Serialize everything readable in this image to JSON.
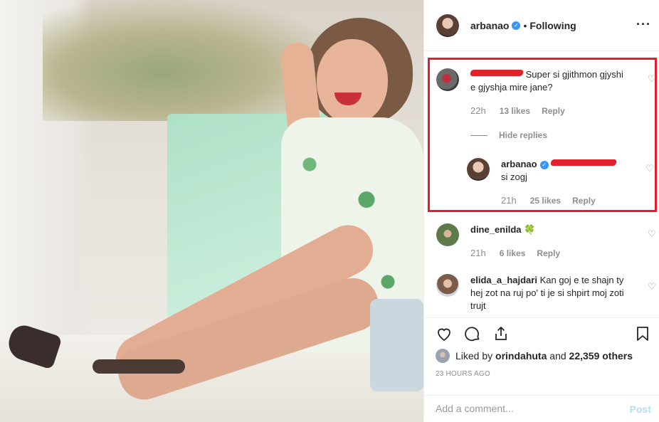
{
  "post": {
    "username": "arbanao",
    "separator": "•",
    "follow_status": "Following",
    "more_icon": "more-options-icon"
  },
  "comments": [
    {
      "username_redacted": true,
      "text": "Super si gjithmon gjyshi e gjyshja mire jane?",
      "time": "22h",
      "likes": "13 likes",
      "reply": "Reply"
    },
    {
      "hide_replies": "Hide replies"
    },
    {
      "username": "arbanao",
      "mention_redacted": true,
      "text": "si zogj",
      "time": "21h",
      "likes": "25 likes",
      "reply": "Reply"
    },
    {
      "username": "dine_enilda",
      "text": "🍀",
      "time": "21h",
      "likes": "6 likes",
      "reply": "Reply"
    },
    {
      "username": "elida_a_hajdari",
      "text": "Kan goj e te shajn ty hej zot na ruj po' ti je si shpirt moj zoti trujt"
    }
  ],
  "actions": {
    "liked_by_prefix": "Liked by",
    "liked_by_user": "orindahuta",
    "liked_by_and": "and",
    "liked_by_count": "22,359 others",
    "timestamp": "23 HOURS AGO",
    "comment_placeholder": "Add a comment...",
    "post_label": "Post"
  },
  "colors": {
    "highlight_border": "#e0202a",
    "verified_blue": "#3897f0",
    "muted_text": "#8e8e8e",
    "post_button_disabled": "#b2dffc"
  }
}
